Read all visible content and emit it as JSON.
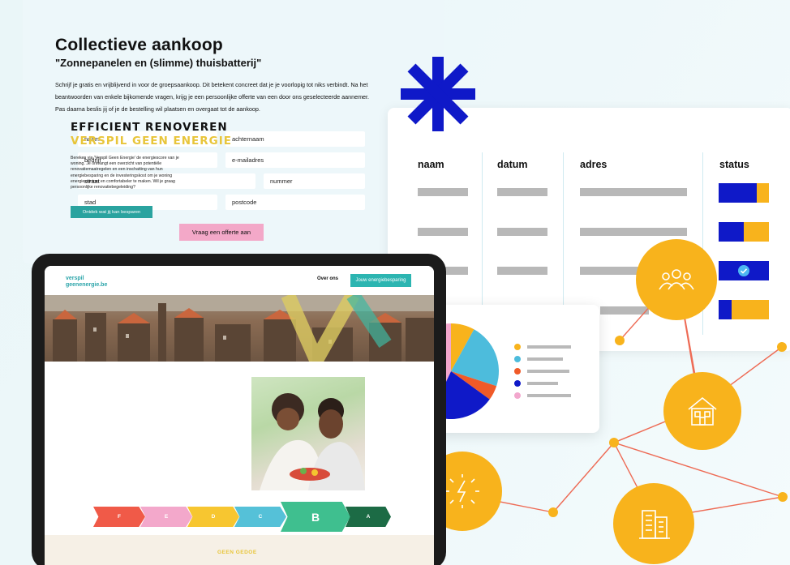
{
  "form": {
    "title": "Collectieve aankoop",
    "subtitle": "\"Zonnepanelen en (slimme) thuisbatterij\"",
    "intro": "Schrijf je gratis en vrijblijvend in voor de groepsaankoop. Dit betekent concreet dat je je voorlopig tot niks verbindt. Na het beantwoorden van enkele bijkomende vragen, krijg je een persoonlijke offerte van een door ons geselecteerde aannemer. Pas daarna beslis jij of je de bestelling wil plaatsen en overgaat tot de aankoop.",
    "fields": {
      "naam": "naam",
      "achternaam": "achternaam",
      "bedrijf": "bedrijf",
      "email": "e-mailadres",
      "straat": "straat",
      "nummer": "nummer",
      "stad": "stad",
      "postcode": "postcode"
    },
    "submit_label": "Vraag een offerte aan"
  },
  "table": {
    "headers": [
      "naam",
      "datum",
      "adres",
      "status"
    ],
    "status_levels": [
      0.75,
      0.5,
      1.0,
      0.25
    ],
    "check_row": 2
  },
  "pie": {
    "slices": [
      {
        "color": "#f8b31c",
        "value": 8
      },
      {
        "color": "#4dbcdc",
        "value": 22
      },
      {
        "color": "#f05a28",
        "value": 5
      },
      {
        "color": "#0f19c8",
        "value": 22
      },
      {
        "color": "#f2a7cd",
        "value": 43
      }
    ]
  },
  "colors": {
    "accent_blue": "#0f19c8",
    "accent_amber": "#f8b31c",
    "network_line": "#ee6b55",
    "teal": "#2cb5b1",
    "pink": "#f3a8c8"
  },
  "icons": [
    "asterisk-icon",
    "people-icon",
    "house-icon",
    "lightbulb-icon",
    "office-building-icon",
    "check-icon"
  ],
  "website": {
    "logo_line1": "verspil",
    "logo_line2": "geenenergie.be",
    "nav_about": "Over ons",
    "nav_cta": "Jouw energiebesparing",
    "headline1": "EFFICIENT RENOVEREN",
    "headline2": "VERSPIL GEEN ENERGIE",
    "body": "Bereken via 'Verspil Geen Energie' de energiescore van je woning. Je ontvangt een overzicht van potentiële renovatiemaatregelen en een inschatting van hun energiebesparing en de investeringskost om je woning energiezuiniger en comfortabeler te maken. Wil je graag persoonlijke renovatiebegeleiding?",
    "cta": "Ontdek wat jij kan besparen",
    "energy_labels": [
      "F",
      "E",
      "D",
      "C",
      "B",
      "A"
    ],
    "footer_text": "GEEN GEDOE"
  }
}
